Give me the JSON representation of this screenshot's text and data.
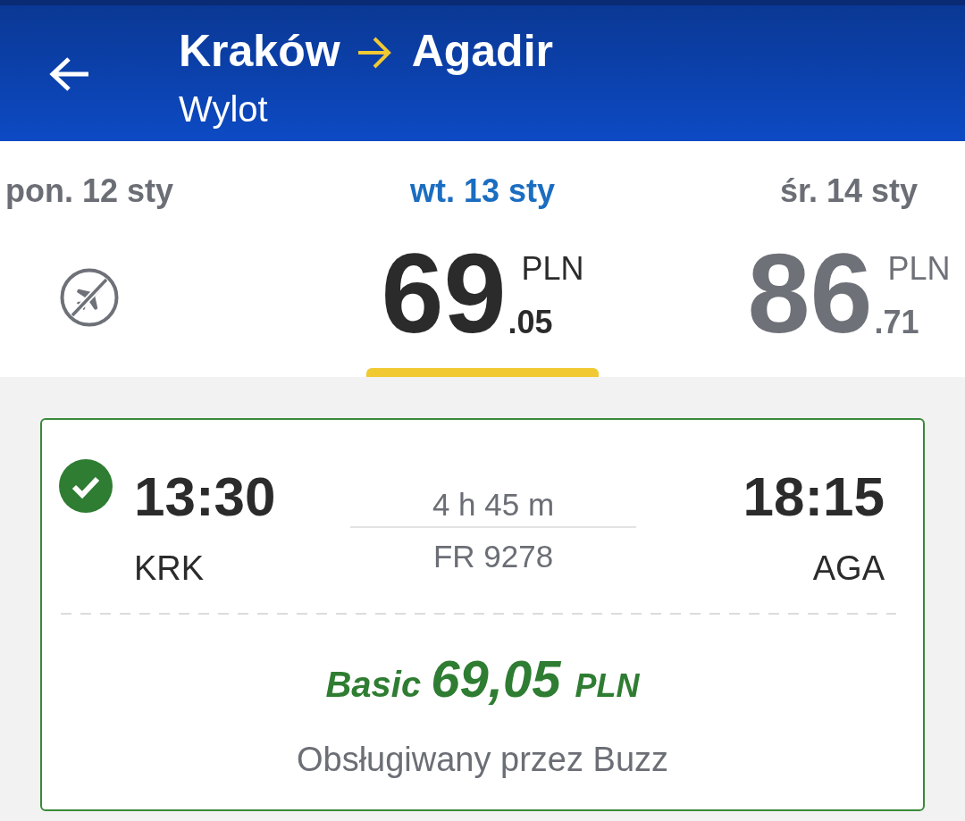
{
  "header": {
    "origin": "Kraków",
    "destination": "Agadir",
    "subtitle": "Wylot"
  },
  "dates": [
    {
      "label": "pon. 12 sty",
      "selected": false,
      "kind": "no_flights"
    },
    {
      "label": "wt. 13 sty",
      "selected": true,
      "kind": "price",
      "price_whole": "69",
      "currency": "PLN",
      "price_decimal": ".05"
    },
    {
      "label": "śr. 14 sty",
      "selected": false,
      "kind": "price",
      "price_whole": "86",
      "currency": "PLN",
      "price_decimal": ".71"
    }
  ],
  "flight": {
    "selected": true,
    "departure_time": "13:30",
    "departure_airport": "KRK",
    "duration": "4 h 45 m",
    "flight_number": "FR 9278",
    "arrival_time": "18:15",
    "arrival_airport": "AGA",
    "fare_name": "Basic",
    "fare_price": "69,05",
    "fare_currency": "PLN",
    "operator": "Obsługiwany przez Buzz"
  }
}
